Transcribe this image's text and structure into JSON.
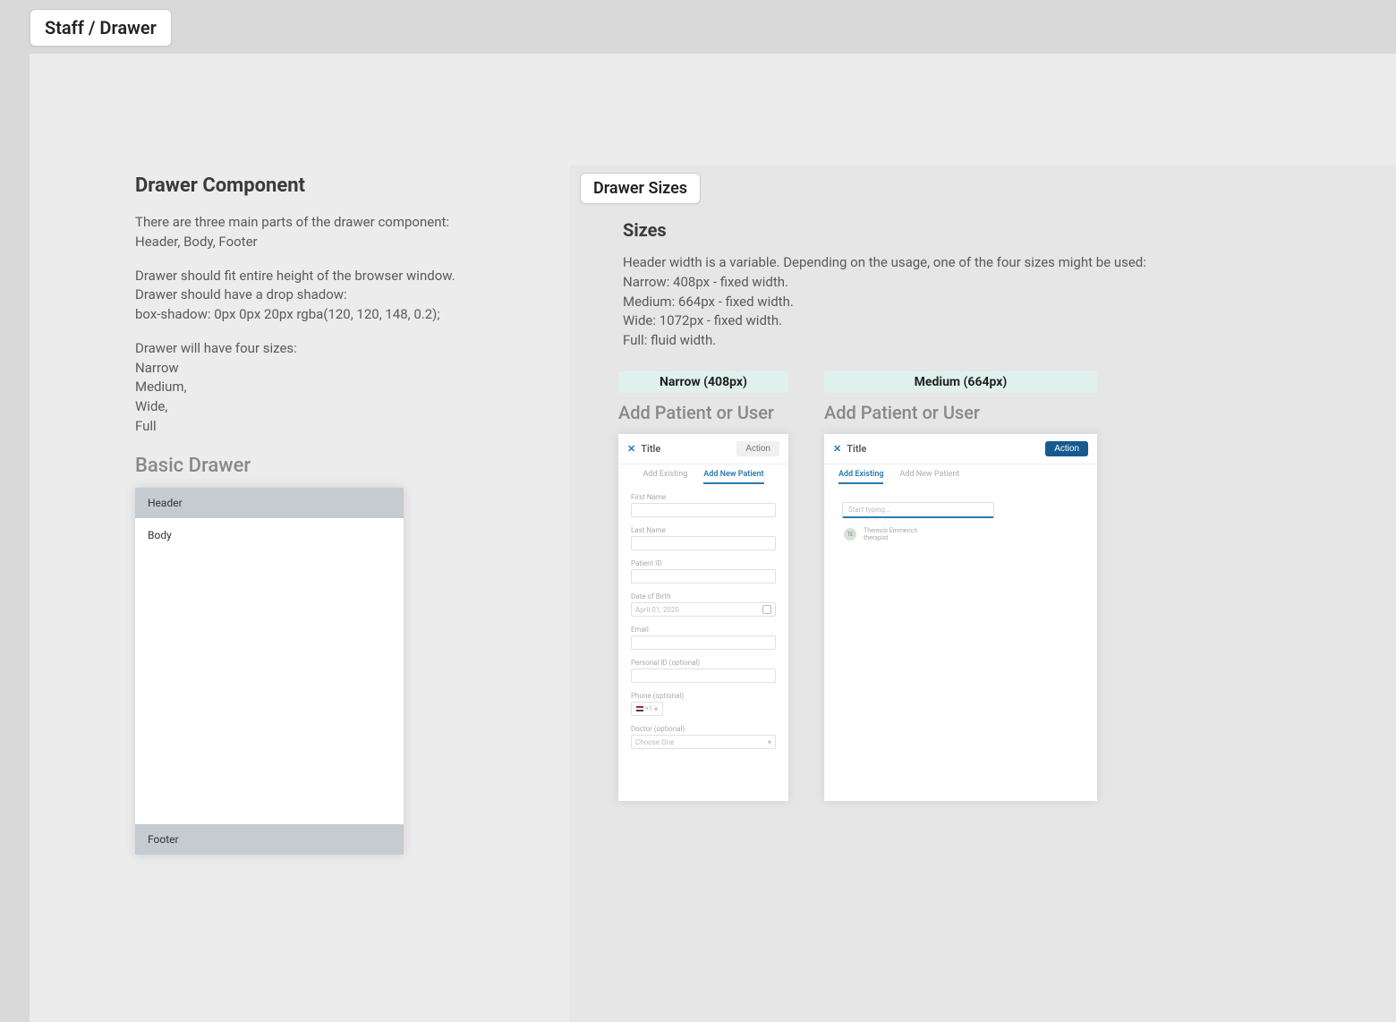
{
  "page_tab": "Staff / Drawer",
  "left": {
    "heading": "Drawer Component",
    "p1": "There are three main parts of the drawer component:\nHeader, Body, Footer",
    "p2": "Drawer should fit entire height of the browser window.\nDrawer should have a drop shadow:\nbox-shadow: 0px 0px 20px rgba(120, 120, 148, 0.2);",
    "p3": "Drawer will have four sizes:\nNarrow\nMedium,\nWide,\nFull",
    "basic_label": "Basic Drawer",
    "basic": {
      "header": "Header",
      "body": "Body",
      "footer": "Footer"
    }
  },
  "right": {
    "tab": "Drawer Sizes",
    "heading": "Sizes",
    "desc": "Header width is a variable. Depending on the usage, one of the four sizes might be used:\nNarrow: 408px - fixed width.\nMedium: 664px - fixed width.\nWide: 1072px - fixed width.\nFull: fluid width.",
    "narrow_label": "Narrow (408px)",
    "medium_label": "Medium (664px)",
    "demo_title": "Add Patient or User",
    "drawer_title": "Title",
    "action": "Action",
    "tabs": {
      "existing": "Add Existing",
      "new": "Add New Patient"
    },
    "fields": {
      "first_name": "First Name",
      "last_name": "Last Name",
      "patient_id": "Patient ID",
      "dob": "Date of Birth",
      "dob_value": "April 01, 2020",
      "email": "Email",
      "personal_id": "Personal ID (optional)",
      "phone": "Phone (optional)",
      "phone_cc": "+1",
      "doctor": "Doctor (optional)",
      "doctor_placeholder": "Choose One"
    },
    "search_placeholder": "Start typing...",
    "result": {
      "initials": "TE",
      "name": "Theresia Emmerich",
      "role": "therapist"
    }
  }
}
